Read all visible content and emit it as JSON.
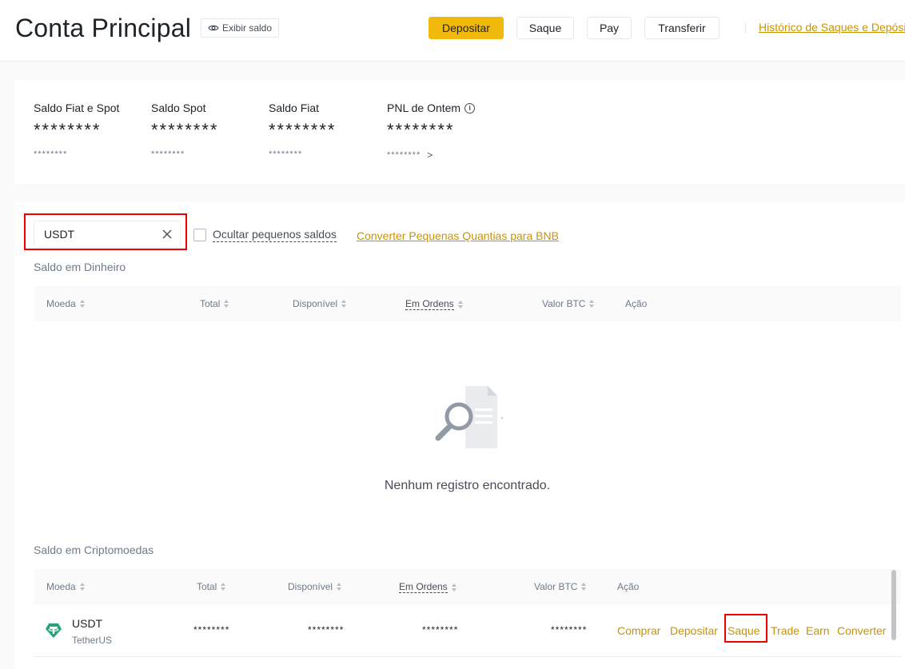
{
  "header": {
    "title": "Conta Principal",
    "show_balance": "Exibir saldo",
    "buttons": {
      "deposit": "Depositar",
      "withdraw": "Saque",
      "pay": "Pay",
      "transfer": "Transferir"
    },
    "history_link": "Histórico de Saques e Depósitos"
  },
  "balances": [
    {
      "label": "Saldo Fiat e Spot",
      "value": "********",
      "sub": "********"
    },
    {
      "label": "Saldo Spot",
      "value": "********",
      "sub": "********"
    },
    {
      "label": "Saldo Fiat",
      "value": "********",
      "sub": "********"
    },
    {
      "label": "PNL de Ontem",
      "value": "********",
      "sub": "********",
      "sub_arrow": ">"
    }
  ],
  "filters": {
    "search_value": "USDT",
    "hide_small_label": "Ocultar pequenos saldos",
    "convert_link": "Converter Pequenas Quantias para BNB"
  },
  "cash_section": {
    "title": "Saldo em Dinheiro",
    "columns": [
      "Moeda",
      "Total",
      "Disponível",
      "Em Ordens",
      "Valor BTC",
      "Ação"
    ],
    "empty_text": "Nenhum registro encontrado."
  },
  "crypto_section": {
    "title": "Saldo em Criptomoedas",
    "columns": [
      "Moeda",
      "Total",
      "Disponível",
      "Em Ordens",
      "Valor BTC",
      "Ação"
    ],
    "rows": [
      {
        "coin": "USDT",
        "coin_name": "TetherUS",
        "total": "********",
        "available": "********",
        "in_orders": "********",
        "btc_value": "********",
        "actions": [
          "Comprar",
          "Depositar",
          "Saque",
          "Trade",
          "Earn",
          "Converter"
        ]
      }
    ]
  },
  "colors": {
    "brand_yellow": "#f0b90b",
    "link_gold": "#c99400",
    "highlight_red": "#ee0000",
    "tether_green": "#26a17b"
  }
}
